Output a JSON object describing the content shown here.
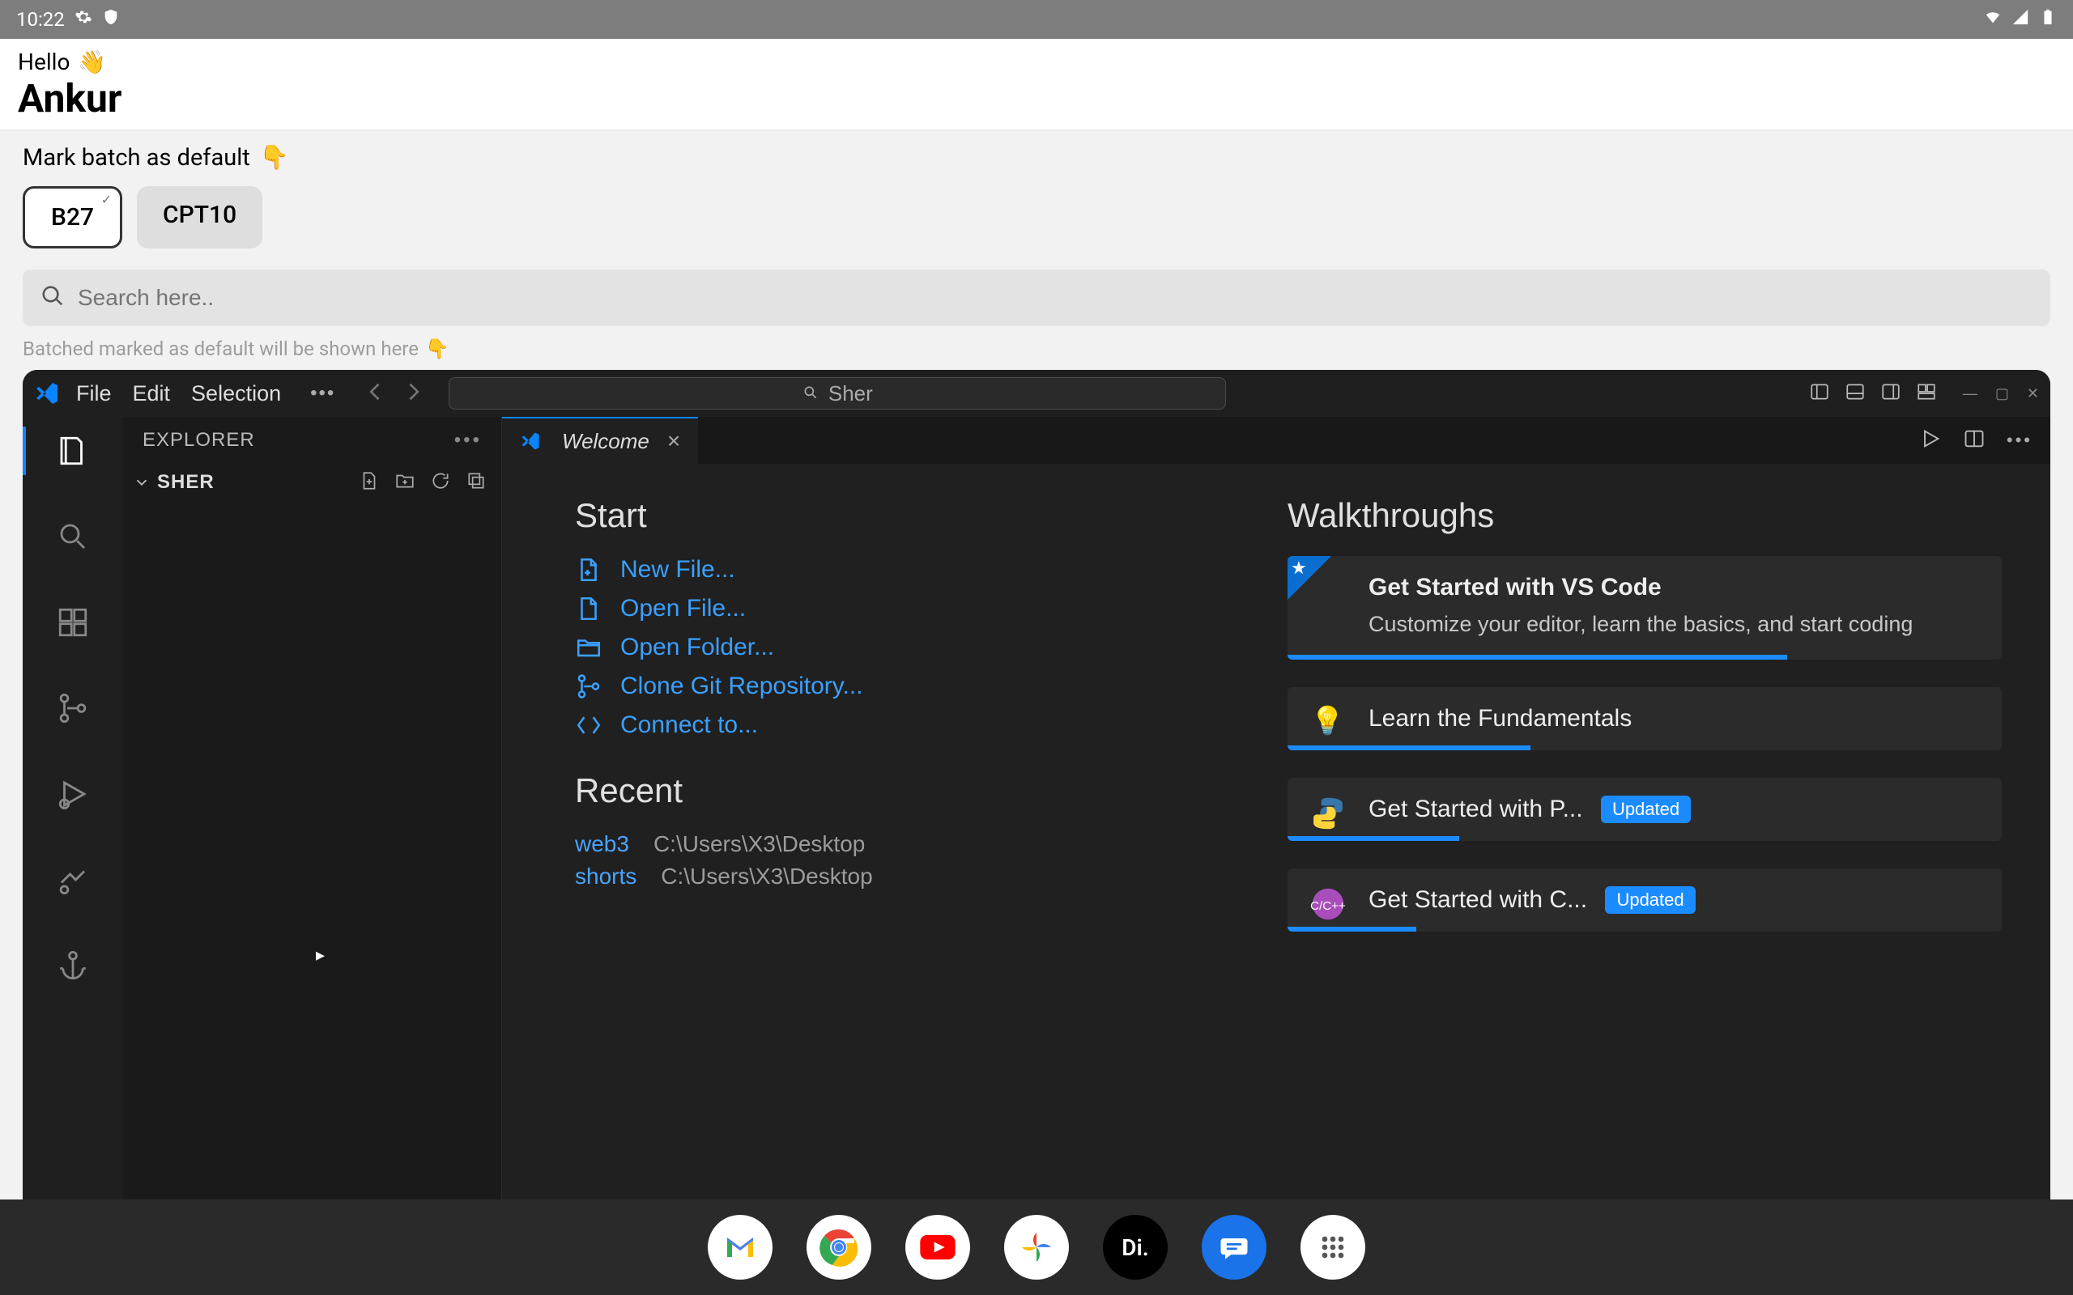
{
  "statusbar": {
    "time": "10:22"
  },
  "app_header": {
    "greeting": "Hello",
    "username": "Ankur"
  },
  "batch": {
    "title": "Mark batch as default",
    "chips": [
      {
        "label": "B27",
        "selected": true
      },
      {
        "label": "CPT10",
        "selected": false
      }
    ],
    "search_placeholder": "Search here..",
    "hint": "Batched marked as default will be shown here"
  },
  "vscode": {
    "menu": [
      "File",
      "Edit",
      "Selection"
    ],
    "search_value": "Sher",
    "explorer": {
      "title": "EXPLORER",
      "folder": "SHER"
    },
    "tab": {
      "label": "Welcome"
    },
    "welcome": {
      "start_heading": "Start",
      "start_items": [
        "New File...",
        "Open File...",
        "Open Folder...",
        "Clone Git Repository...",
        "Connect to..."
      ],
      "recent_heading": "Recent",
      "recent": [
        {
          "name": "web3",
          "path": "C:\\Users\\X3\\Desktop"
        },
        {
          "name": "shorts",
          "path": "C:\\Users\\X3\\Desktop"
        }
      ],
      "walkthroughs_heading": "Walkthroughs",
      "walkthroughs": [
        {
          "title": "Get Started with VS Code",
          "desc": "Customize your editor, learn the basics, and start coding",
          "starred": true,
          "progress_pct": 70,
          "updated": false,
          "icon": "star"
        },
        {
          "title": "Learn the Fundamentals",
          "desc": "",
          "starred": false,
          "progress_pct": 34,
          "updated": false,
          "icon": "bulb"
        },
        {
          "title": "Get Started with P...",
          "desc": "",
          "starred": false,
          "progress_pct": 24,
          "updated": true,
          "icon": "python"
        },
        {
          "title": "Get Started with C...",
          "desc": "",
          "starred": false,
          "progress_pct": 18,
          "updated": true,
          "icon": "cpp"
        }
      ],
      "updated_badge": "Updated"
    }
  },
  "taskbar": {
    "items": [
      "gmail",
      "chrome",
      "youtube",
      "photos",
      "di",
      "messages",
      "apps"
    ]
  }
}
